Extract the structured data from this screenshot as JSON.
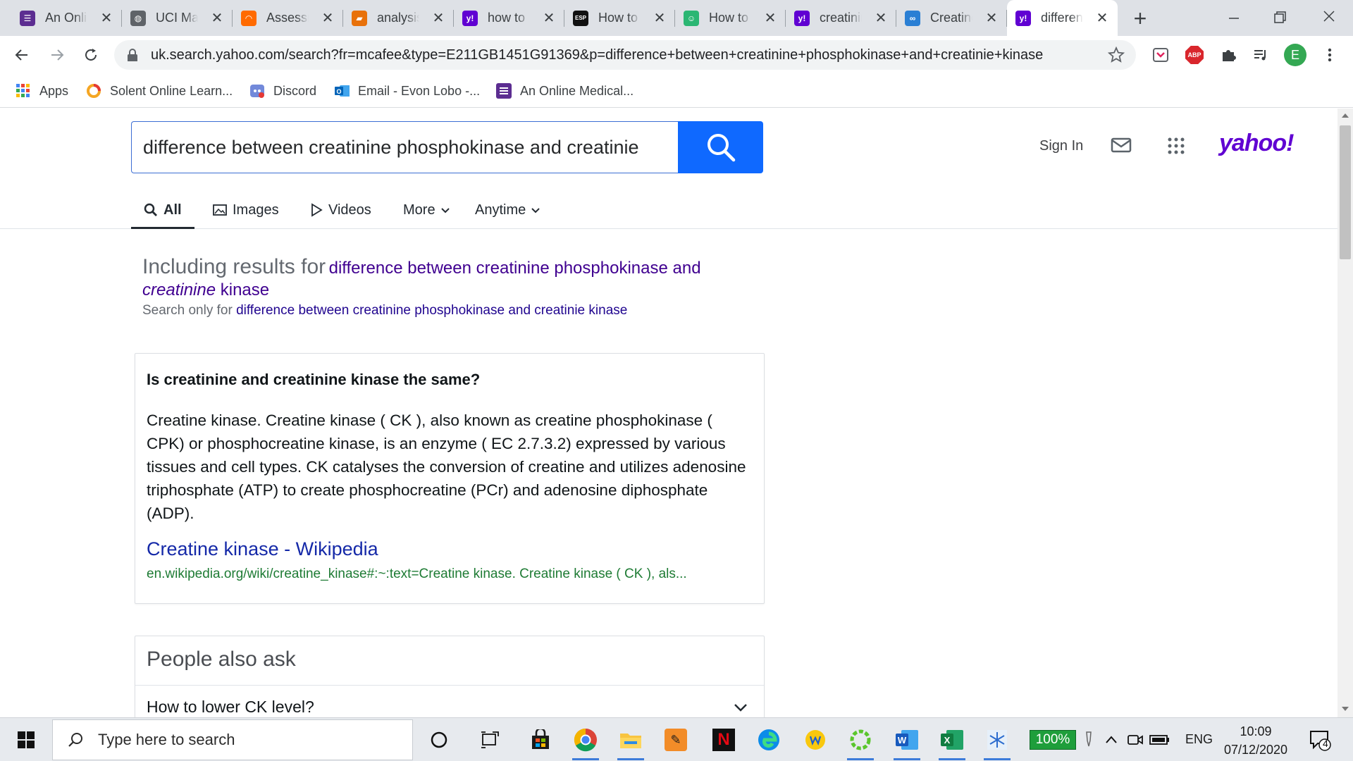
{
  "browser": {
    "tabs": [
      {
        "title": "An Online Medical...",
        "favicon": "list-icon",
        "color": "#5c2d91",
        "glyph": "☰"
      },
      {
        "title": "UCI Machine...",
        "favicon": "globe-icon",
        "color": "#5f6368",
        "glyph": "◍"
      },
      {
        "title": "Assessment",
        "favicon": "arc-icon",
        "color": "#ff6a00",
        "glyph": "◠"
      },
      {
        "title": "analysis",
        "favicon": "document-icon",
        "color": "#e8710a",
        "glyph": "▰"
      },
      {
        "title": "how to",
        "favicon": "yahoo-icon",
        "color": "#6001d2",
        "glyph": "y!"
      },
      {
        "title": "How to",
        "favicon": "esp-icon",
        "color": "#111111",
        "glyph": "ESP"
      },
      {
        "title": "How to",
        "favicon": "robot-icon",
        "color": "#2bb673",
        "glyph": "☺"
      },
      {
        "title": "creatinine",
        "favicon": "yahoo-icon",
        "color": "#6001d2",
        "glyph": "y!"
      },
      {
        "title": "Creatine",
        "favicon": "cyclist-icon",
        "color": "#2a7fd4",
        "glyph": "∞"
      },
      {
        "title": "difference",
        "favicon": "yahoo-icon",
        "color": "#6001d2",
        "glyph": "y!"
      }
    ],
    "new_tab_symbol": "+",
    "close_symbol": "✕",
    "url": "uk.search.yahoo.com/search?fr=mcafee&type=E211GB1451G91369&p=difference+between+creatinine+phosphokinase+and+creatinie+kinase",
    "profile_initial": "E",
    "abp_label": "ABP"
  },
  "bookmarks": [
    {
      "label": "Apps",
      "icon": "apps-grid-icon"
    },
    {
      "label": "Solent Online Learn...",
      "icon": "solent-ring-icon"
    },
    {
      "label": "Discord",
      "icon": "discord-icon"
    },
    {
      "label": "Email - Evon Lobo -...",
      "icon": "outlook-icon"
    },
    {
      "label": "An Online Medical...",
      "icon": "list-icon"
    }
  ],
  "search": {
    "query": "difference between creatinine phosphokinase and creatinie",
    "sign_in": "Sign In",
    "logo": "yahoo!"
  },
  "nav_tabs": {
    "all": "All",
    "images": "Images",
    "videos": "Videos",
    "more": "More",
    "anytime": "Anytime"
  },
  "spelling": {
    "including_prefix": "Including results for",
    "corrected_part1": "difference between creatinine phosphokinase and",
    "corrected_italic": "creatinine",
    "corrected_part2": "kinase",
    "search_only_prefix": "Search only for",
    "search_only_link": "difference between creatinine phosphokinase and creatinie kinase"
  },
  "answer_card": {
    "question": "Is creatinine and creatinine kinase the same?",
    "answer": "Creatine kinase. Creatine kinase ( CK ), also known as creatine phosphokinase ( CPK) or phosphocreatine kinase, is an enzyme ( EC 2.7.3.2) expressed by various tissues and cell types. CK catalyses the conversion of creatine and utilizes adenosine triphosphate (ATP) to create phosphocreatine (PCr) and adenosine diphosphate (ADP).",
    "source_title": "Creatine kinase - Wikipedia",
    "source_url": "en.wikipedia.org/wiki/creatine_kinase#:~:text=Creatine kinase. Creatine kinase ( CK ), als..."
  },
  "people_also_ask": {
    "heading": "People also ask",
    "items": [
      "How to lower CK level?"
    ]
  },
  "taskbar": {
    "search_placeholder": "Type here to search",
    "battery_label": "100%",
    "language": "ENG",
    "time": "10:09",
    "date": "07/12/2020",
    "notification_count": "4"
  }
}
